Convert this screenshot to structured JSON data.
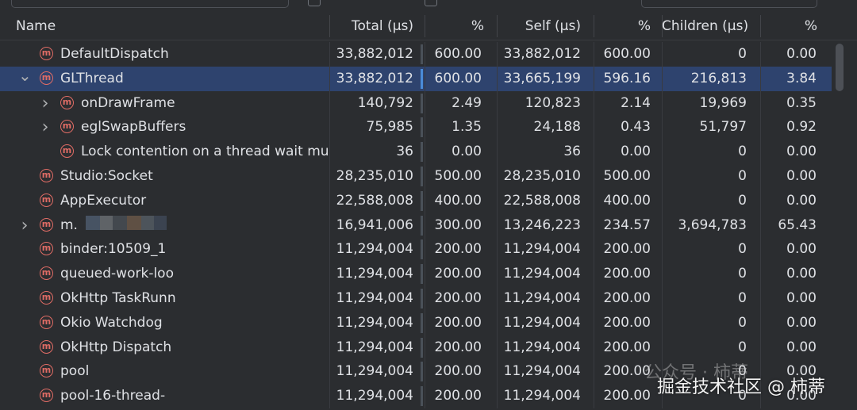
{
  "header": {
    "name": "Name",
    "total": "Total (µs)",
    "total_pct": "%",
    "self": "Self (µs)",
    "self_pct": "%",
    "children": "Children (µs)",
    "children_pct": "%"
  },
  "rows": [
    {
      "level": 0,
      "expand": "",
      "name": "DefaultDispatch",
      "total": "33,882,012",
      "total_pct": "600.00",
      "self": "33,882,012",
      "self_pct": "600.00",
      "children": "0",
      "children_pct": "0.00",
      "selected": false
    },
    {
      "level": 0,
      "expand": "open",
      "name": "GLThread",
      "total": "33,882,012",
      "total_pct": "600.00",
      "self": "33,665,199",
      "self_pct": "596.16",
      "children": "216,813",
      "children_pct": "3.84",
      "selected": true
    },
    {
      "level": 1,
      "expand": "closed",
      "name": "onDrawFrame",
      "total": "140,792",
      "total_pct": "2.49",
      "self": "120,823",
      "self_pct": "2.14",
      "children": "19,969",
      "children_pct": "0.35",
      "selected": false
    },
    {
      "level": 1,
      "expand": "closed",
      "name": "eglSwapBuffers",
      "total": "75,985",
      "total_pct": "1.35",
      "self": "24,188",
      "self_pct": "0.43",
      "children": "51,797",
      "children_pct": "0.92",
      "selected": false
    },
    {
      "level": 1,
      "expand": "",
      "name": "Lock contention on a thread wait mut",
      "total": "36",
      "total_pct": "0.00",
      "self": "36",
      "self_pct": "0.00",
      "children": "0",
      "children_pct": "0.00",
      "selected": false
    },
    {
      "level": 0,
      "expand": "",
      "name": "Studio:Socket",
      "total": "28,235,010",
      "total_pct": "500.00",
      "self": "28,235,010",
      "self_pct": "500.00",
      "children": "0",
      "children_pct": "0.00",
      "selected": false
    },
    {
      "level": 0,
      "expand": "",
      "name": "AppExecutor",
      "total": "22,588,008",
      "total_pct": "400.00",
      "self": "22,588,008",
      "self_pct": "400.00",
      "children": "0",
      "children_pct": "0.00",
      "selected": false
    },
    {
      "level": 0,
      "expand": "closed",
      "name": "m.",
      "total": "16,941,006",
      "total_pct": "300.00",
      "self": "13,246,223",
      "self_pct": "234.57",
      "children": "3,694,783",
      "children_pct": "65.43",
      "selected": false
    },
    {
      "level": 0,
      "expand": "",
      "name": "binder:10509_1",
      "total": "11,294,004",
      "total_pct": "200.00",
      "self": "11,294,004",
      "self_pct": "200.00",
      "children": "0",
      "children_pct": "0.00",
      "selected": false
    },
    {
      "level": 0,
      "expand": "",
      "name": "queued-work-loo",
      "total": "11,294,004",
      "total_pct": "200.00",
      "self": "11,294,004",
      "self_pct": "200.00",
      "children": "0",
      "children_pct": "0.00",
      "selected": false
    },
    {
      "level": 0,
      "expand": "",
      "name": "OkHttp TaskRunn",
      "total": "11,294,004",
      "total_pct": "200.00",
      "self": "11,294,004",
      "self_pct": "200.00",
      "children": "0",
      "children_pct": "0.00",
      "selected": false
    },
    {
      "level": 0,
      "expand": "",
      "name": "Okio Watchdog",
      "total": "11,294,004",
      "total_pct": "200.00",
      "self": "11,294,004",
      "self_pct": "200.00",
      "children": "0",
      "children_pct": "0.00",
      "selected": false
    },
    {
      "level": 0,
      "expand": "",
      "name": "OkHttp Dispatch",
      "total": "11,294,004",
      "total_pct": "200.00",
      "self": "11,294,004",
      "self_pct": "200.00",
      "children": "0",
      "children_pct": "0.00",
      "selected": false
    },
    {
      "level": 0,
      "expand": "",
      "name": "pool",
      "total": "11,294,004",
      "total_pct": "200.00",
      "self": "11,294,004",
      "self_pct": "200.00",
      "children": "0",
      "children_pct": "0.00",
      "selected": false
    },
    {
      "level": 0,
      "expand": "",
      "name": "pool-16-thread-",
      "total": "11,294,004",
      "total_pct": "200.00",
      "self": "11,294,004",
      "self_pct": "200.00",
      "children": "0",
      "children_pct": "0.00",
      "selected": false
    }
  ],
  "method_icon_glyph": "m",
  "icon_names": {
    "method": "method-icon",
    "expand_open": "chevron-down-icon",
    "expand_closed": "chevron-right-icon"
  },
  "colors": {
    "background": "#2b2d30",
    "selected_row": "#2e436e",
    "method_icon": "#e06c65",
    "selected_bar": "#4a8bd8"
  },
  "watermark": {
    "line1": "公众号 · 柿蒂",
    "line2": "掘金技术社区 @ 柿蒂"
  }
}
